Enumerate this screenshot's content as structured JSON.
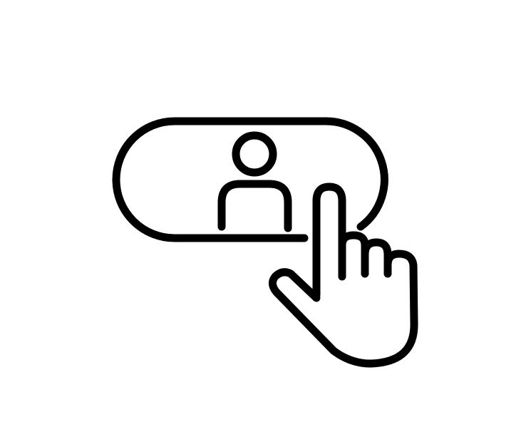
{
  "illustration": {
    "icon": "user-select-button-with-pointing-hand-icon",
    "parts": [
      "pill-button-icon",
      "user-avatar-icon",
      "pointing-hand-icon"
    ],
    "stroke_color": "#000000",
    "background_color": "#ffffff"
  }
}
